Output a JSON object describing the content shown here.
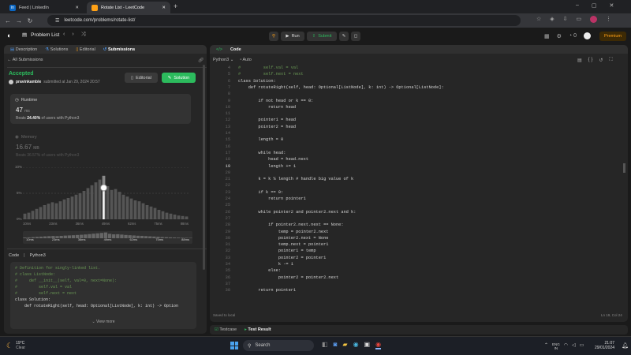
{
  "browser": {
    "tabs": [
      {
        "label": "Feed | LinkedIn",
        "badge": "in"
      },
      {
        "label": "Rotate List - LeetCode"
      }
    ],
    "url": "leetcode.com/problems/rotate-list/"
  },
  "lc": {
    "problem_list": "Problem List",
    "run": "Run",
    "submit": "Submit",
    "zero": "0",
    "premium": "Premium"
  },
  "left": {
    "tabs": [
      "Description",
      "Solutions",
      "Editorial",
      "Submissions"
    ],
    "all_subs": "All Submissions",
    "status": "Accepted",
    "user": "pravinkamble",
    "submitted": "submitted at Jan 29, 2024 20:57",
    "editorial_btn": "Editorial",
    "solution_btn": "Solution",
    "runtime_label": "Runtime",
    "runtime_val": "47",
    "runtime_unit": "ms",
    "beats_prefix": "Beats",
    "beats_pct": "24.40%",
    "beats_suffix": "of users with Python3",
    "memory_label": "Memory",
    "mem_val": "16.67",
    "mem_unit": "MB",
    "mem_beats_prefix": "Beats",
    "mem_beats_pct": "36.57%",
    "mem_beats_suffix": "of users with Python3",
    "yticks": [
      "10%",
      "5%",
      "0%"
    ],
    "xticks": [
      "10ms",
      "23ms",
      "36ms",
      "49ms",
      "62ms",
      "75ms",
      "88ms"
    ],
    "mini_ticks": [
      "10ms",
      "23ms",
      "36ms",
      "49ms",
      "62ms",
      "75ms",
      "88ms"
    ],
    "code_label": "Code",
    "lang": "Python3",
    "snippet": [
      {
        "t": "# Definition for singly-linked list.",
        "c": "cm"
      },
      {
        "t": "# class ListNode:",
        "c": "cm"
      },
      {
        "t": "#     def __init__(self, val=0, next=None):",
        "c": "cm"
      },
      {
        "t": "#         self.val = val",
        "c": "cm"
      },
      {
        "t": "#         self.next = next",
        "c": "cm"
      },
      {
        "t": "class Solution:",
        "c": ""
      },
      {
        "t": "    def rotateRight(self, head: Optional[ListNode], k: int) -> Option",
        "c": ""
      }
    ],
    "view_more": "View more"
  },
  "right": {
    "title": "Code",
    "lang": "Python3",
    "auto": "Auto",
    "lines": [
      {
        "n": "4",
        "t": "#         self.val = val",
        "c": "cm"
      },
      {
        "n": "5",
        "t": "#         self.next = next",
        "c": "cm"
      },
      {
        "n": "6",
        "t": "class Solution:",
        "c": ""
      },
      {
        "n": "7",
        "t": "    def rotateRight(self, head: Optional[ListNode], k: int) -> Optional[ListNode]:",
        "c": ""
      },
      {
        "n": "8",
        "t": "",
        "c": ""
      },
      {
        "n": "9",
        "t": "        if not head or k == 0:",
        "c": ""
      },
      {
        "n": "10",
        "t": "            return head",
        "c": ""
      },
      {
        "n": "11",
        "t": "",
        "c": ""
      },
      {
        "n": "12",
        "t": "        pointer1 = head",
        "c": ""
      },
      {
        "n": "13",
        "t": "        pointer2 = head",
        "c": ""
      },
      {
        "n": "14",
        "t": "",
        "c": ""
      },
      {
        "n": "15",
        "t": "        length = 0",
        "c": ""
      },
      {
        "n": "16",
        "t": "",
        "c": ""
      },
      {
        "n": "17",
        "t": "        while head:",
        "c": ""
      },
      {
        "n": "18",
        "t": "            head = head.next",
        "c": ""
      },
      {
        "n": "19",
        "t": "            length += 1",
        "c": ""
      },
      {
        "n": "20",
        "t": "",
        "c": ""
      },
      {
        "n": "21",
        "t": "        k = k % length # handle big value of k",
        "c": ""
      },
      {
        "n": "22",
        "t": "",
        "c": ""
      },
      {
        "n": "23",
        "t": "        if k == 0:",
        "c": ""
      },
      {
        "n": "24",
        "t": "            return pointer1",
        "c": ""
      },
      {
        "n": "25",
        "t": "",
        "c": ""
      },
      {
        "n": "26",
        "t": "        while pointer2 and pointer2.next and k:",
        "c": ""
      },
      {
        "n": "27",
        "t": "",
        "c": ""
      },
      {
        "n": "28",
        "t": "            if pointer2.next.next == None:",
        "c": ""
      },
      {
        "n": "29",
        "t": "                temp = pointer2.next",
        "c": ""
      },
      {
        "n": "30",
        "t": "                pointer2.next = None",
        "c": ""
      },
      {
        "n": "31",
        "t": "                temp.next = pointer1",
        "c": ""
      },
      {
        "n": "32",
        "t": "                pointer1 = temp",
        "c": ""
      },
      {
        "n": "33",
        "t": "                pointer2 = pointer1",
        "c": ""
      },
      {
        "n": "34",
        "t": "                k -= 1",
        "c": ""
      },
      {
        "n": "35",
        "t": "            else:",
        "c": ""
      },
      {
        "n": "36",
        "t": "                pointer2 = pointer2.next",
        "c": ""
      },
      {
        "n": "37",
        "t": "",
        "c": ""
      },
      {
        "n": "38",
        "t": "        return pointer1",
        "c": ""
      }
    ],
    "saved": "Saved to local",
    "cursor": "Ln 19, Col 24",
    "testcase": "Testcase",
    "test_result": "Test Result"
  },
  "taskbar": {
    "temp": "19°C",
    "weather": "Clear",
    "search": "Search",
    "lang": "ENG",
    "region": "IN",
    "time": "21:07",
    "date": "29/01/2024"
  },
  "histogram": [
    0.12,
    0.14,
    0.18,
    0.22,
    0.26,
    0.3,
    0.33,
    0.36,
    0.34,
    0.38,
    0.42,
    0.45,
    0.48,
    0.52,
    0.55,
    0.6,
    0.66,
    0.72,
    0.78,
    0.84,
    0.92,
    0.7,
    0.62,
    0.64,
    0.58,
    0.52,
    0.48,
    0.44,
    0.4,
    0.38,
    0.34,
    0.3,
    0.27,
    0.24,
    0.2,
    0.17,
    0.14,
    0.12,
    0.1,
    0.08,
    0.07,
    0.06
  ],
  "chart_data": {
    "type": "bar",
    "title": "Runtime",
    "categories": [
      "10ms",
      "23ms",
      "36ms",
      "49ms",
      "62ms",
      "75ms",
      "88ms"
    ],
    "yticks": [
      "0%",
      "5%",
      "10%"
    ],
    "highlight": "47 ms"
  }
}
